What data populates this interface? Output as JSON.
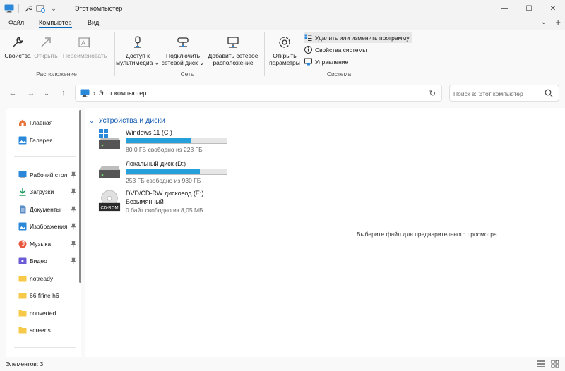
{
  "window": {
    "title": "Этот компьютер",
    "controls": {
      "minimize": "—",
      "maximize": "☐",
      "close": "✕"
    }
  },
  "menu": {
    "items": [
      {
        "label": "Файл"
      },
      {
        "label": "Компьютер",
        "active": true
      },
      {
        "label": "Вид"
      }
    ],
    "help_icon": "⌄",
    "new_tab_icon": "+"
  },
  "ribbon": {
    "location_group": {
      "label": "Расположение",
      "buttons": [
        {
          "label": "Свойства",
          "icon": "wrench-icon",
          "enabled": true
        },
        {
          "label": "Открыть",
          "icon": "open-icon",
          "enabled": false
        },
        {
          "label": "Переименовать",
          "icon": "rename-icon",
          "enabled": false
        }
      ]
    },
    "network_group": {
      "label": "Сеть",
      "buttons": [
        {
          "line1": "Доступ к",
          "line2": "мультимедиа ⌄",
          "icon": "media-access-icon"
        },
        {
          "line1": "Подключить",
          "line2": "сетевой диск ⌄",
          "icon": "network-drive-icon"
        },
        {
          "line1": "Добавить сетевое",
          "line2": "расположение",
          "icon": "network-location-icon"
        }
      ]
    },
    "system_group": {
      "label": "Система",
      "open_settings": {
        "line1": "Открыть",
        "line2": "параметры",
        "icon": "gear-icon"
      },
      "items": [
        {
          "label": "Удалить или изменить программу",
          "icon": "programs-icon",
          "highlighted": true
        },
        {
          "label": "Свойства системы",
          "icon": "info-icon"
        },
        {
          "label": "Управление",
          "icon": "manage-icon"
        }
      ]
    }
  },
  "navigation": {
    "back": "←",
    "forward": "→",
    "recent": "⌄",
    "up": "↑",
    "chevron": "›",
    "address": "Этот компьютер",
    "refresh": "↻",
    "search_placeholder": "Поиск в: Этот компьютер"
  },
  "sidebar": {
    "top_items": [
      {
        "label": "Главная",
        "icon": "home-icon"
      },
      {
        "label": "Галерея",
        "icon": "gallery-icon"
      }
    ],
    "pinned_items": [
      {
        "label": "Рабочий стол",
        "icon": "desktop-icon",
        "pinned": true
      },
      {
        "label": "Загрузки",
        "icon": "downloads-icon",
        "pinned": true
      },
      {
        "label": "Документы",
        "icon": "documents-icon",
        "pinned": true
      },
      {
        "label": "Изображения",
        "icon": "pictures-icon",
        "pinned": true
      },
      {
        "label": "Музыка",
        "icon": "music-icon",
        "pinned": true
      },
      {
        "label": "Видео",
        "icon": "video-icon",
        "pinned": true
      },
      {
        "label": "notready",
        "icon": "folder-icon",
        "pinned": false
      },
      {
        "label": "66 fifine h6",
        "icon": "folder-icon",
        "pinned": false
      },
      {
        "label": "converted",
        "icon": "folder-icon",
        "pinned": false
      },
      {
        "label": "screens",
        "icon": "folder-icon",
        "pinned": false
      }
    ]
  },
  "main": {
    "group_title": "Устройства и диски",
    "drives": [
      {
        "name": "Windows 11 (C:)",
        "free": "80,0 ГБ свободно из 223 ГБ",
        "used_fraction": 0.64,
        "icon": "windows-drive-icon"
      },
      {
        "name": "Локальный диск (D:)",
        "free": "253 ГБ свободно из 930 ГБ",
        "used_fraction": 0.73,
        "icon": "hard-drive-icon"
      },
      {
        "name": "DVD/CD-RW дисковод (E:)",
        "subtitle": "Безымянный",
        "free": "0 байт свободно из 8,05 МБ",
        "icon": "cd-rom-icon",
        "badge": "CD-ROM"
      }
    ]
  },
  "preview": {
    "text": "Выберите файл для предварительного просмотра."
  },
  "status": {
    "items_count": "Элементов: 3"
  },
  "colors": {
    "accent": "#0067c0",
    "drive_bar": "#26a0da",
    "group_header": "#1a5fb4"
  }
}
